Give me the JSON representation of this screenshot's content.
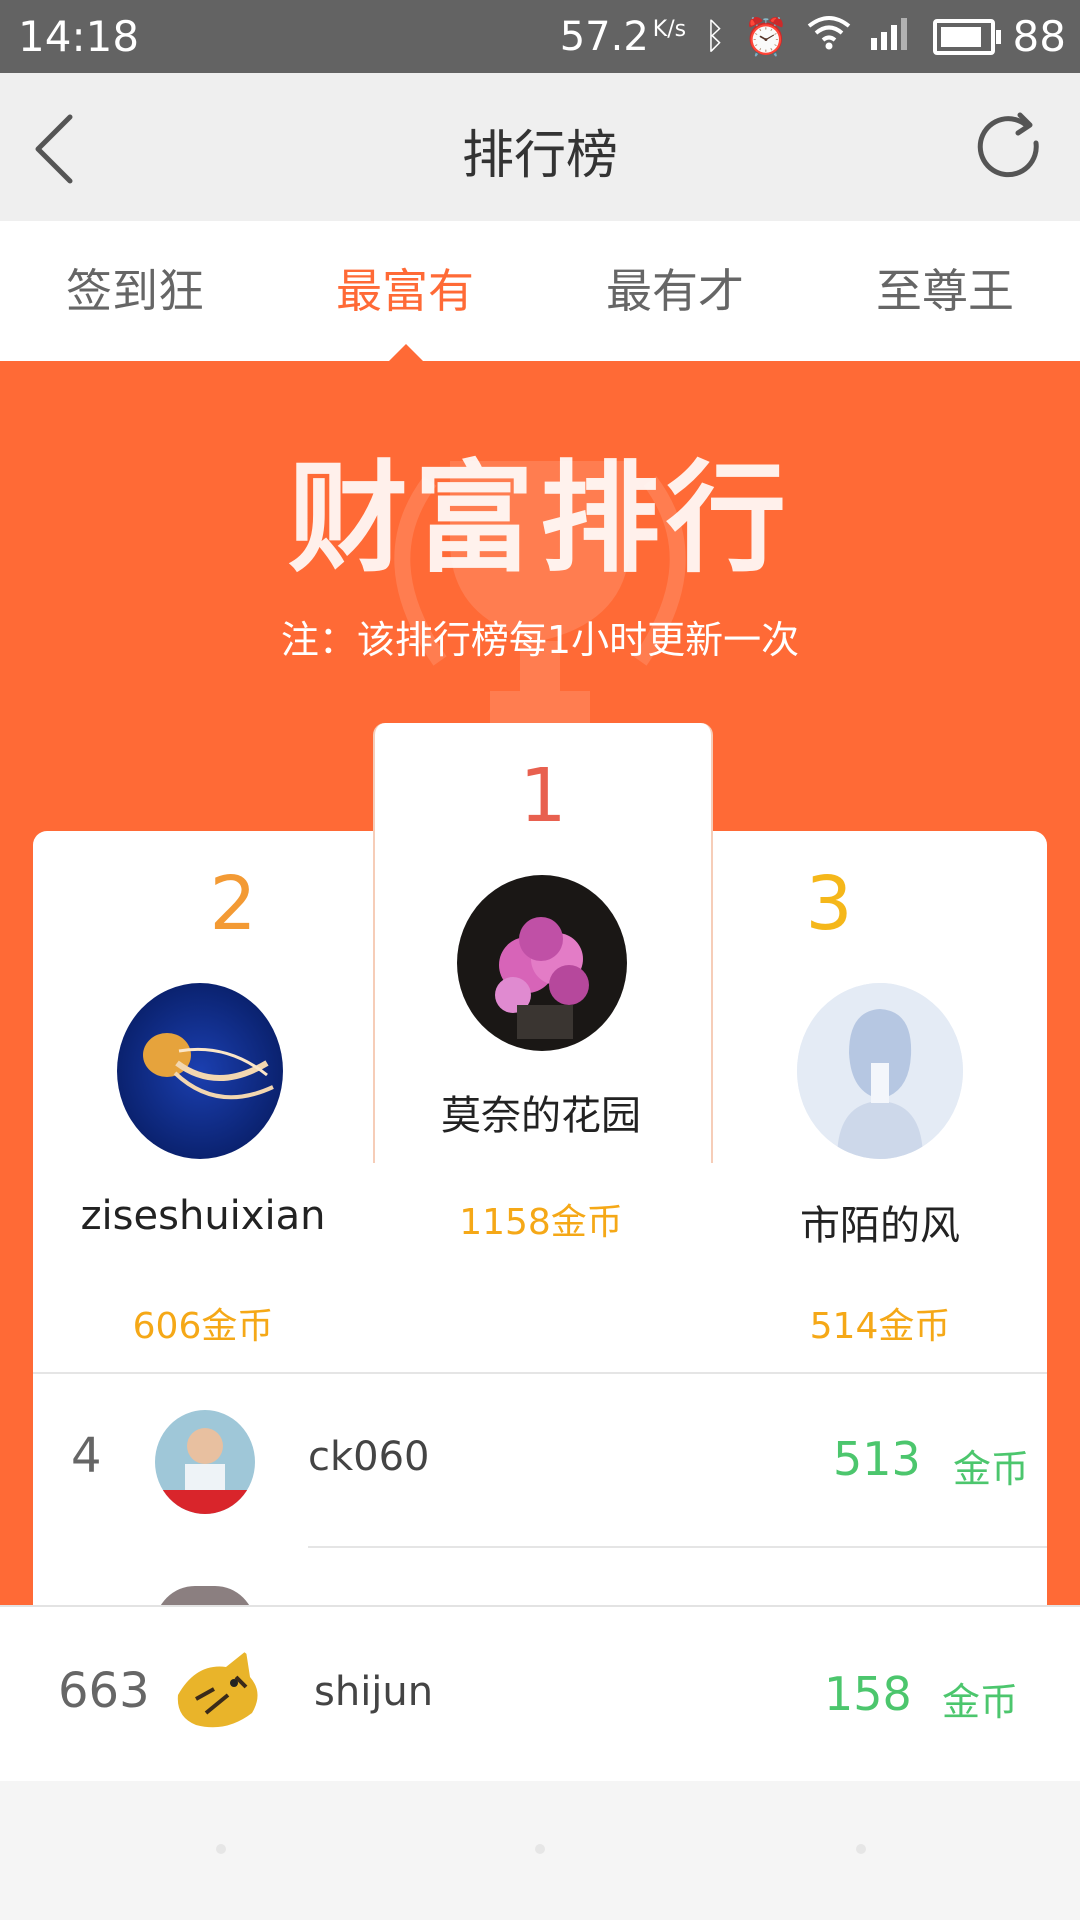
{
  "status_bar": {
    "time": "14:18",
    "speed": "57.2",
    "speed_unit": "K/s",
    "battery": "88",
    "battery_level": 0.88
  },
  "header": {
    "title": "排行榜",
    "back_icon": "chevron-left-icon",
    "refresh_icon": "refresh-icon"
  },
  "tabs": [
    {
      "label": "签到狂",
      "active": false
    },
    {
      "label": "最富有",
      "active": true
    },
    {
      "label": "最有才",
      "active": false
    },
    {
      "label": "至尊王",
      "active": false
    }
  ],
  "banner": {
    "title": "财富排行",
    "note": "注：该排行榜每1小时更新一次"
  },
  "podium": {
    "first": {
      "rank": "1",
      "name": "莫奈的花园",
      "coins": "1158金币"
    },
    "second": {
      "rank": "2",
      "name": "ziseshuixian",
      "coins": "606金币"
    },
    "third": {
      "rank": "3",
      "name": "市陌的风",
      "coins": "514金币"
    }
  },
  "list": [
    {
      "rank": "4",
      "name": "ck060",
      "value": "513",
      "unit": "金币"
    }
  ],
  "my_rank": {
    "rank": "663",
    "name": "shijun",
    "value": "158",
    "unit": "金币"
  },
  "colors": {
    "accent": "#ff6a36",
    "rank1": "#e8604f",
    "rank2": "#f39a34",
    "rank3": "#f5b71a",
    "coin_text": "#f5a817",
    "value_green": "#4cc66d"
  }
}
